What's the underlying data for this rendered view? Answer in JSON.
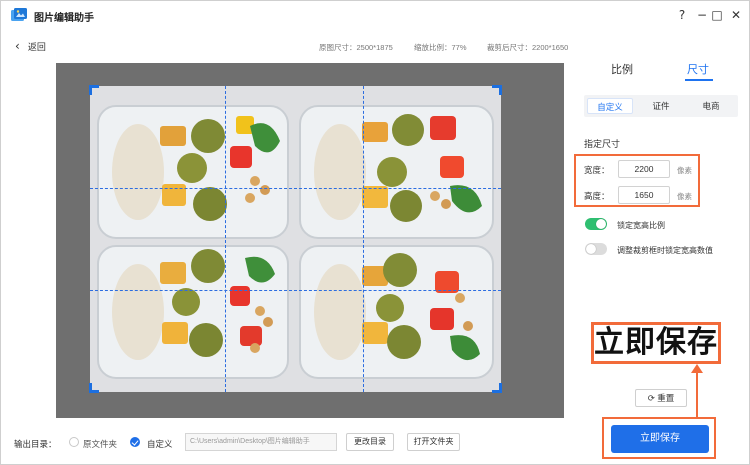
{
  "app": {
    "title": "图片编辑助手",
    "window_controls": {
      "help": "?",
      "minimize": "−",
      "maximize": "□",
      "close": "✕"
    }
  },
  "header": {
    "back_label": "返回",
    "original_size": "原图尺寸：2500*1875",
    "zoom_ratio": "缩放比例：77%",
    "cropped_size": "裁剪后尺寸：2200*1650"
  },
  "panel": {
    "tabs": [
      {
        "label": "比例",
        "active": false
      },
      {
        "label": "尺寸",
        "active": true
      }
    ],
    "subtabs": [
      {
        "label": "自定义",
        "active": true
      },
      {
        "label": "证件",
        "active": false
      },
      {
        "label": "电商",
        "active": false
      }
    ],
    "section_label": "指定尺寸",
    "width_label": "宽度：",
    "width_value": "2200",
    "height_label": "高度：",
    "height_value": "1650",
    "unit": "像素",
    "toggles": [
      {
        "label": "锁定宽高比例",
        "on": true
      },
      {
        "label": "调整裁剪框时锁定宽高数值",
        "on": false
      }
    ],
    "callout_text": "立即保存",
    "reset_label": "重置",
    "save_label": "立即保存"
  },
  "bottom": {
    "output_label": "输出目录：",
    "options": [
      {
        "label": "原文件夹",
        "selected": false
      },
      {
        "label": "自定义",
        "selected": true
      }
    ],
    "path_value": "C:\\Users\\admin\\Desktop\\图片编辑助手",
    "change_dir_label": "更改目录",
    "open_folder_label": "打开文件夹"
  },
  "colors": {
    "accent": "#1f6fe8",
    "highlight": "#f26b3a",
    "toggle_on": "#2fbf71",
    "toggle_off": "#dcdcdc"
  }
}
